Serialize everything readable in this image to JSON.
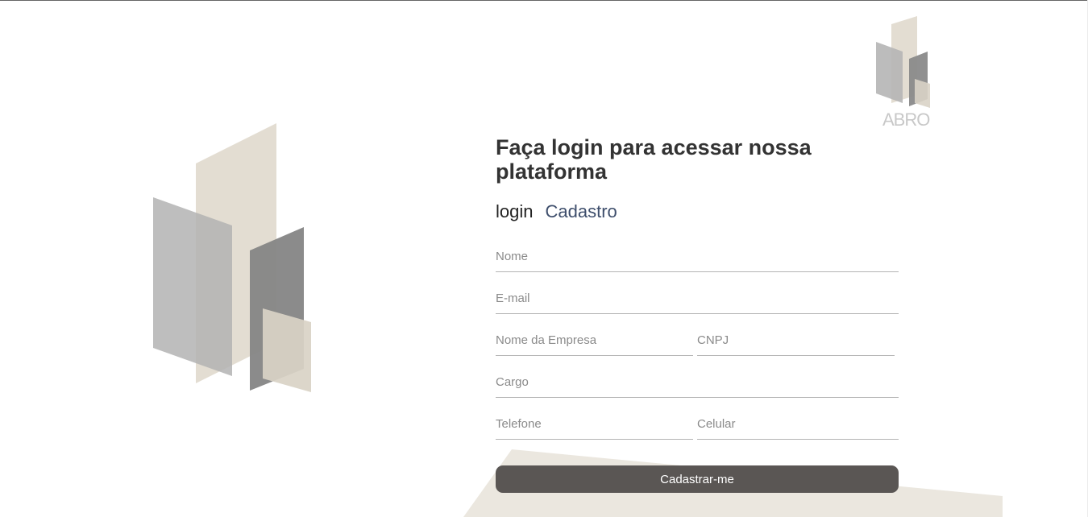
{
  "logo": {
    "text": "ABRO"
  },
  "heading": "Faça login para acessar nossa plataforma",
  "tabs": [
    {
      "label": "login",
      "active": false
    },
    {
      "label": "Cadastro",
      "active": true
    }
  ],
  "form": {
    "nome_placeholder": "Nome",
    "email_placeholder": "E-mail",
    "empresa_placeholder": "Nome da Empresa",
    "cnpj_placeholder": "CNPJ",
    "cargo_placeholder": "Cargo",
    "telefone_placeholder": "Telefone",
    "celular_placeholder": "Celular",
    "submit_label": "Cadastrar-me"
  },
  "colors": {
    "beige": "#e3ddd2",
    "light_gray": "#bcbcbc",
    "dark_gray": "#8c8c8c",
    "button": "#5a5654",
    "tab_active": "#3e4e6c"
  }
}
